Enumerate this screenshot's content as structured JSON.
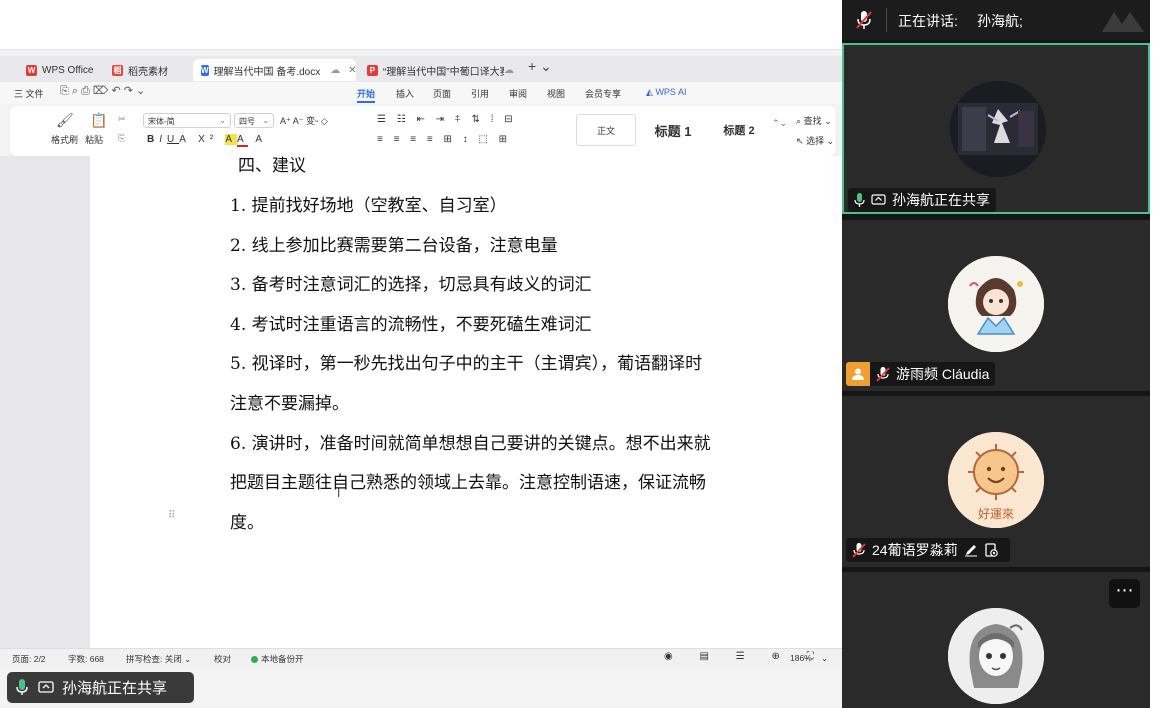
{
  "wps": {
    "tabs": [
      {
        "label": "WPS Office",
        "icon": "W",
        "color": "#e63a3a"
      },
      {
        "label": "稻壳素材",
        "icon": "稻",
        "color": "#e6463a"
      },
      {
        "label": "理解当代中国 备考.docx",
        "icon": "W",
        "color": "#2f6ee8"
      },
      {
        "label": "“理解当代中国”中葡口译大赛题",
        "icon": "P",
        "color": "#e63a3a"
      }
    ],
    "tab_add": "+ ⌄",
    "menu": {
      "file": "三 文件",
      "items": [
        "开始",
        "插入",
        "页面",
        "引用",
        "审阅",
        "视图",
        "会员专享"
      ],
      "wps_ai": "WPS AI"
    },
    "ribbon": {
      "format_painter": "格式刷",
      "paste": "粘贴",
      "font": "宋体-简",
      "size": "四号",
      "style_normal": "正文",
      "style_h1": "标题 1",
      "style_h2": "标题 2",
      "find": "查找",
      "select": "选择"
    },
    "document": {
      "lines": [
        "四、建议",
        "1.  提前找好场地（空教室、自习室）",
        "2.  线上参加比赛需要第二台设备，注意电量",
        "3.  备考时注意词汇的选择，切忌具有歧义的词汇",
        "4.  考试时注重语言的流畅性，不要死磕生难词汇",
        "5.  视译时，第一秒先找出句子中的主干（主谓宾），葡语翻译时",
        "注意不要漏掉。",
        "6.  演讲时，准备时间就简单想想自己要讲的关键点。想不出来就",
        "把题目主题往自己熟悉的领域上去靠。注意控制语速，保证流畅",
        "度。"
      ]
    },
    "status": {
      "page": "页面: 2/2",
      "words": "字数: 668",
      "spell": "拼写检查: 关闭 ⌄",
      "proof": "校对",
      "backup": "本地备份开",
      "zoom": "186%"
    }
  },
  "sharing_pill": "孙海航正在共享",
  "meeting": {
    "speaking_label": "正在讲话:",
    "speaker": "孙海航;",
    "participants": [
      {
        "name": "孙海航正在共享"
      },
      {
        "name": "游雨频 Cláudia"
      },
      {
        "name": "24葡语罗淼莉"
      },
      {
        "name": ""
      }
    ],
    "more": "⋯"
  }
}
